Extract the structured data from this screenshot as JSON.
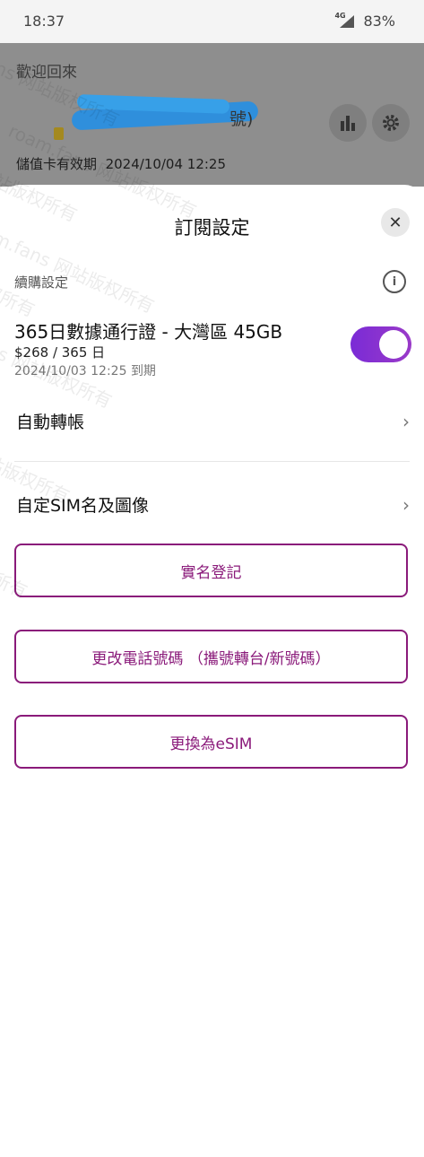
{
  "status": {
    "time": "18:37",
    "network": "4G",
    "battery": "83%"
  },
  "background": {
    "welcome": "歡迎回來",
    "number_suffix": "號)",
    "expiry_label": "儲值卡有效期",
    "expiry_value": "2024/10/04 12:25",
    "icons": [
      "bar-chart-icon",
      "gear-icon"
    ]
  },
  "sheet": {
    "title": "訂閱設定",
    "section_label": "續購設定",
    "plan": {
      "name": "365日數據通行證 - 大灣區 45GB",
      "price": "$268 / 365 日",
      "expiry": "2024/10/03 12:25 到期",
      "auto_renew": true
    },
    "menu": [
      {
        "label": "自動轉帳"
      },
      {
        "label": "自定SIM名及圖像"
      }
    ],
    "buttons": [
      {
        "label": "實名登記"
      },
      {
        "label": "更改電話號碼 （攜號轉台/新號碼）"
      },
      {
        "label": "更換為eSIM"
      }
    ]
  },
  "watermark": "roam.fans 网站版权所有",
  "colors": {
    "accent": "#8a1a7a",
    "toggle_on": "#7a2bd6"
  }
}
